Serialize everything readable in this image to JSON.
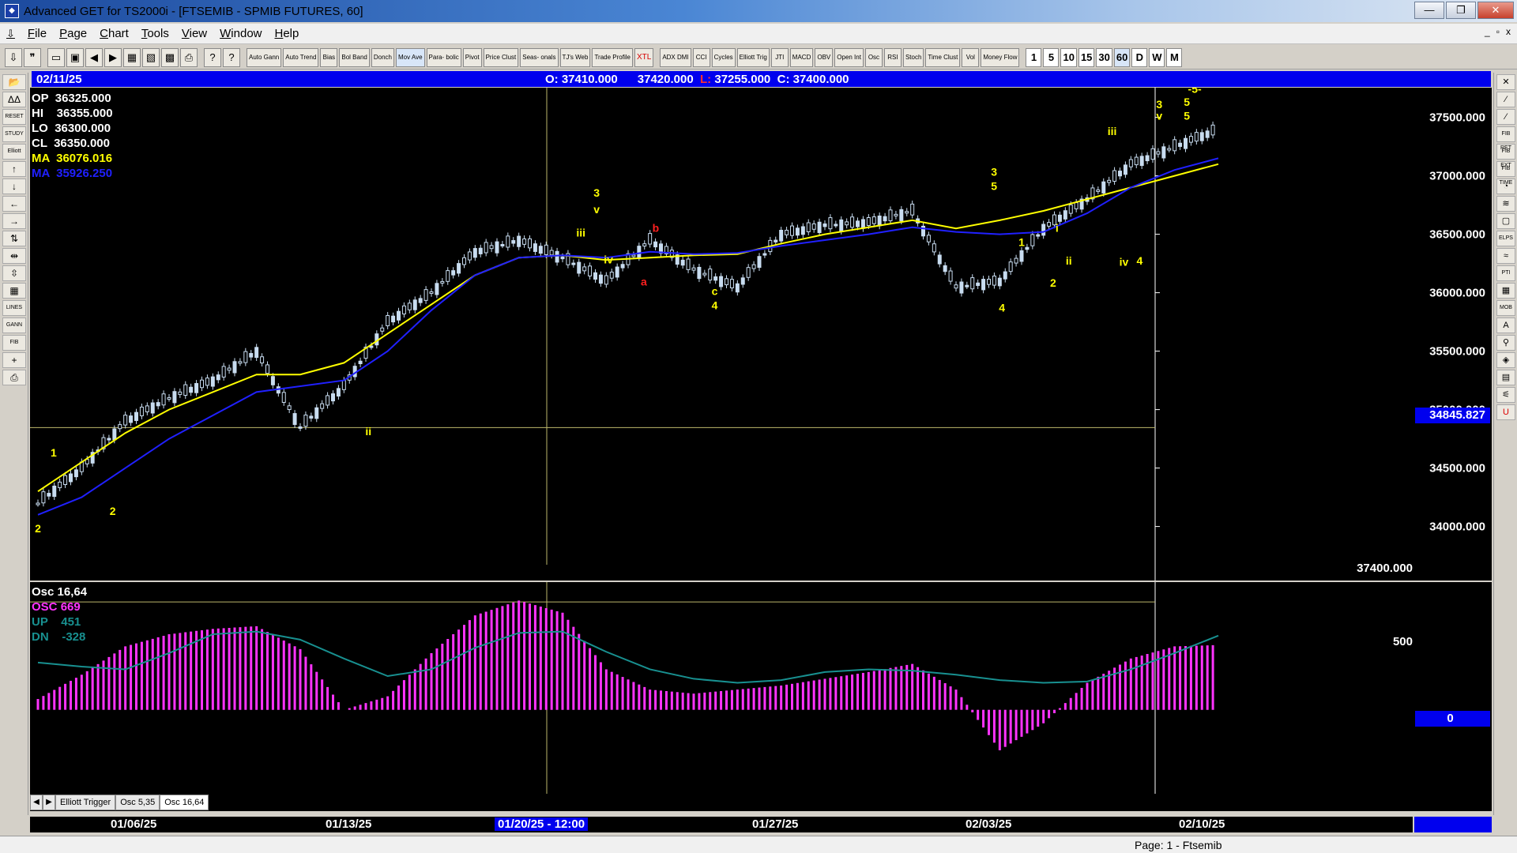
{
  "window": {
    "title": "Advanced GET for TS2000i - [FTSEMIB - SPMIB FUTURES, 60]"
  },
  "window_buttons": {
    "minimize": "—",
    "maximize": "❐",
    "close": "✕"
  },
  "menu": [
    "File",
    "Page",
    "Chart",
    "Tools",
    "View",
    "Window",
    "Help"
  ],
  "mdi_buttons": {
    "minimize": "_",
    "restore": "▫",
    "close": "x"
  },
  "toolbar": {
    "icon_buttons": [
      "⇩",
      "❞",
      "▭",
      "▣",
      "◀",
      "▶",
      "▦",
      "▧",
      "▩",
      "⎙",
      "?",
      "?"
    ],
    "study_buttons": [
      "Auto Gann",
      "Auto Trend",
      "Bias",
      "Bol Band",
      "Donch",
      "Mov Ave",
      "Para- bolic",
      "Pivot",
      "Price Clust",
      "Seas- onals",
      "TJ's Web",
      "Trade Profile",
      "XTL",
      "ADX DMI",
      "CCI",
      "Cycles",
      "Elliott Trig",
      "JTI",
      "MACD",
      "OBV",
      "Open Int",
      "Osc",
      "RSI",
      "Stoch",
      "Time Clust",
      "Vol",
      "Money Flow"
    ],
    "periods": [
      "1",
      "5",
      "10",
      "15",
      "30",
      "60",
      "D",
      "W",
      "M"
    ],
    "active_period": "60"
  },
  "left_tools": [
    "📂",
    "ΔΔ",
    "RESET",
    "STUDY",
    "Elliott",
    "↑",
    "↓",
    "←",
    "→",
    "⇅",
    "⇹",
    "⇳",
    "▦",
    "LINES",
    "GANN",
    "FIB",
    "+",
    "⎙"
  ],
  "right_tools": [
    "✕",
    "⁄",
    "⁄",
    "FIB RET",
    "FIB EXT",
    "FIB TIME",
    "◔",
    "≋",
    "▢",
    "ELPS",
    "≈",
    "PTI",
    "▦",
    "MOB",
    "A",
    "⚲",
    "◈",
    "▤",
    "⚟",
    "U"
  ],
  "header": {
    "date": "02/11/25",
    "open_label": "O:",
    "open": "37410.000",
    "high": "37420.000",
    "low_label": "L:",
    "low": "37255.000",
    "close_label": "C:",
    "close": "37400.000"
  },
  "info_panel": {
    "op_label": "OP",
    "op": "36325.000",
    "hi_label": "HI",
    "hi": "36355.000",
    "lo_label": "LO",
    "lo": "36300.000",
    "cl_label": "CL",
    "cl": "36350.000",
    "ma1_label": "MA",
    "ma1": "36076.016",
    "ma2_label": "MA",
    "ma2": "35926.250"
  },
  "price_axis": {
    "labels": [
      "37500.000",
      "37000.000",
      "36500.000",
      "36000.000",
      "35500.000",
      "35000.000",
      "34500.000",
      "34000.000"
    ],
    "cursor_price": "34845.827",
    "last_close": "37400.000"
  },
  "osc_panel": {
    "title": "Osc 16,64",
    "osc_label": "OSC",
    "osc": "669",
    "up_label": "UP",
    "up": "451",
    "dn_label": "DN",
    "dn": "-328",
    "axis_500": "500",
    "axis_zero": "0"
  },
  "tabs": {
    "nav_prev": "◀",
    "nav_next": "▶",
    "items": [
      "Elliott Trigger",
      "Osc 5,35",
      "Osc 16,64"
    ],
    "active": "Osc 16,64"
  },
  "time_axis": {
    "labels": [
      "01/06/25",
      "01/13/25",
      "01/20/25 - 12:00",
      "01/27/25",
      "02/03/25",
      "02/10/25"
    ],
    "selected": "01/20/25 - 12:00"
  },
  "status": {
    "page": "Page: 1 - Ftsemib"
  },
  "colors": {
    "background": "#000000",
    "candles": "#c8dcf0",
    "ma_fast": "#ffff00",
    "ma_slow": "#2020ff",
    "osc_bars": "#ff33ff",
    "osc_line": "#189090",
    "wave_labels": "#ffff00",
    "abc_labels": "#ff2020",
    "header_blue": "#0000ee"
  },
  "wave_labels": [
    "1",
    "2",
    "2",
    "ii",
    "iii",
    "3",
    "v",
    "iv",
    "a",
    "b",
    "c",
    "4",
    "3",
    "5",
    "4",
    "1",
    "2",
    "i",
    "ii",
    "iii",
    "iv",
    "4",
    "3",
    "v",
    "5",
    "5",
    "-5-"
  ],
  "chart_data": {
    "type": "candlestick",
    "title": "FTSEMIB - SPMIB FUTURES, 60",
    "ylim": [
      33700,
      37700
    ],
    "x": [
      "01/03/25",
      "01/06/25",
      "01/07/25",
      "01/08/25",
      "01/09/25",
      "01/10/25",
      "01/13/25",
      "01/14/25",
      "01/15/25",
      "01/16/25",
      "01/17/25",
      "01/20/25",
      "01/21/25",
      "01/22/25",
      "01/23/25",
      "01/24/25",
      "01/27/25",
      "01/28/25",
      "01/29/25",
      "01/30/25",
      "01/31/25",
      "02/03/25",
      "02/04/25",
      "02/05/25",
      "02/06/25",
      "02/07/25",
      "02/10/25",
      "02/11/25"
    ],
    "close": [
      34200,
      34500,
      34900,
      35100,
      35250,
      35500,
      34850,
      35200,
      35750,
      36000,
      36350,
      36450,
      36300,
      36100,
      36450,
      36200,
      36050,
      36500,
      36580,
      36600,
      36700,
      36050,
      36100,
      36550,
      36800,
      37100,
      37250,
      37400
    ],
    "series": [
      {
        "name": "MA",
        "values": [
          34300,
          34550,
          34800,
          35000,
          35150,
          35300,
          35300,
          35400,
          35650,
          35900,
          36150,
          36300,
          36320,
          36280,
          36300,
          36320,
          36330,
          36420,
          36500,
          36560,
          36620,
          36550,
          36620,
          36700,
          36800,
          36900,
          37000,
          37100
        ]
      },
      {
        "name": "MA",
        "values": [
          34100,
          34250,
          34500,
          34750,
          34950,
          35150,
          35200,
          35250,
          35500,
          35850,
          36150,
          36300,
          36320,
          36300,
          36350,
          36330,
          36340,
          36400,
          36450,
          36500,
          36560,
          36520,
          36500,
          36520,
          36680,
          36900,
          37050,
          37150
        ]
      }
    ],
    "osc": {
      "name": "OSC",
      "values": [
        80,
        260,
        470,
        560,
        600,
        620,
        450,
        0,
        100,
        420,
        700,
        810,
        720,
        300,
        150,
        120,
        150,
        180,
        230,
        280,
        340,
        150,
        -300,
        -100,
        200,
        380,
        470,
        480
      ],
      "signal": [
        350,
        320,
        300,
        420,
        560,
        580,
        520,
        380,
        250,
        300,
        460,
        570,
        580,
        430,
        300,
        230,
        200,
        220,
        280,
        300,
        290,
        260,
        220,
        200,
        210,
        300,
        420,
        550
      ]
    }
  }
}
